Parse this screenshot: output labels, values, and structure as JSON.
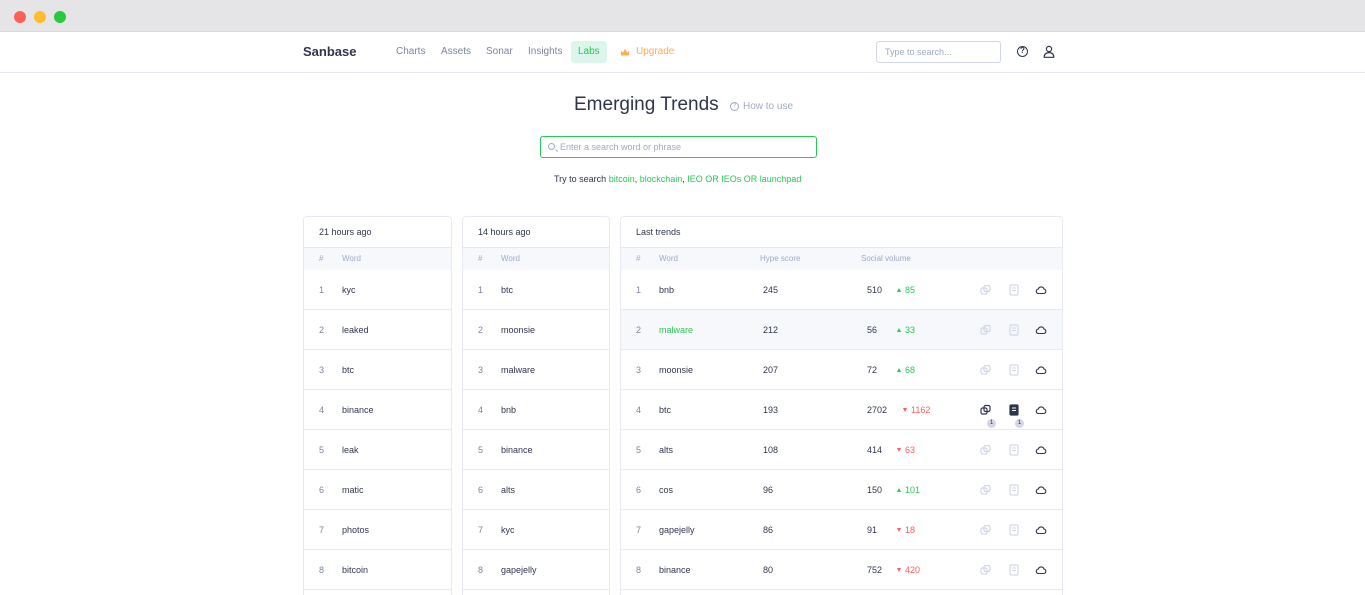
{
  "nav": {
    "logo": "Sanbase",
    "links": [
      "Charts",
      "Assets",
      "Sonar",
      "Insights",
      "Labs"
    ],
    "upgrade": "Upgrade",
    "search_placeholder": "Type to search..."
  },
  "header": {
    "title": "Emerging Trends",
    "how_to_use": "How to use",
    "search_placeholder": "Enter a search word or phrase",
    "try_prefix": "Try to search",
    "try_links": [
      "bitcoin",
      "blockchain",
      "IEO OR IEOs OR launchpad"
    ]
  },
  "colors": {
    "accent": "#26c953",
    "down": "#ff5b5b",
    "upgrade": "#ffad4d"
  },
  "panels": [
    {
      "title": "21 hours ago",
      "col_num": "#",
      "col_word": "Word",
      "rows": [
        {
          "n": "1",
          "w": "kyc"
        },
        {
          "n": "2",
          "w": "leaked"
        },
        {
          "n": "3",
          "w": "btc"
        },
        {
          "n": "4",
          "w": "binance"
        },
        {
          "n": "5",
          "w": "leak"
        },
        {
          "n": "6",
          "w": "matic"
        },
        {
          "n": "7",
          "w": "photos"
        },
        {
          "n": "8",
          "w": "bitcoin"
        }
      ]
    },
    {
      "title": "14 hours ago",
      "col_num": "#",
      "col_word": "Word",
      "rows": [
        {
          "n": "1",
          "w": "btc"
        },
        {
          "n": "2",
          "w": "moonsie"
        },
        {
          "n": "3",
          "w": "malware"
        },
        {
          "n": "4",
          "w": "bnb"
        },
        {
          "n": "5",
          "w": "binance"
        },
        {
          "n": "6",
          "w": "alts"
        },
        {
          "n": "7",
          "w": "kyc"
        },
        {
          "n": "8",
          "w": "gapejelly"
        }
      ]
    }
  ],
  "last_trends": {
    "title": "Last trends",
    "col_num": "#",
    "col_word": "Word",
    "col_hype": "Hype score",
    "col_social": "Social volume",
    "rows": [
      {
        "n": "1",
        "w": "bnb",
        "hype": "245",
        "vol": "510",
        "chg": "85",
        "dir": "up"
      },
      {
        "n": "2",
        "w": "malware",
        "hype": "212",
        "vol": "56",
        "chg": "33",
        "dir": "up"
      },
      {
        "n": "3",
        "w": "moonsie",
        "hype": "207",
        "vol": "72",
        "chg": "68",
        "dir": "up"
      },
      {
        "n": "4",
        "w": "btc",
        "hype": "193",
        "vol": "2702",
        "chg": "1162",
        "dir": "down",
        "badge1": "1",
        "badge2": "1"
      },
      {
        "n": "5",
        "w": "alts",
        "hype": "108",
        "vol": "414",
        "chg": "63",
        "dir": "down"
      },
      {
        "n": "6",
        "w": "cos",
        "hype": "96",
        "vol": "150",
        "chg": "101",
        "dir": "up"
      },
      {
        "n": "7",
        "w": "gapejelly",
        "hype": "86",
        "vol": "91",
        "chg": "18",
        "dir": "down"
      },
      {
        "n": "8",
        "w": "binance",
        "hype": "80",
        "vol": "752",
        "chg": "420",
        "dir": "down"
      }
    ]
  }
}
